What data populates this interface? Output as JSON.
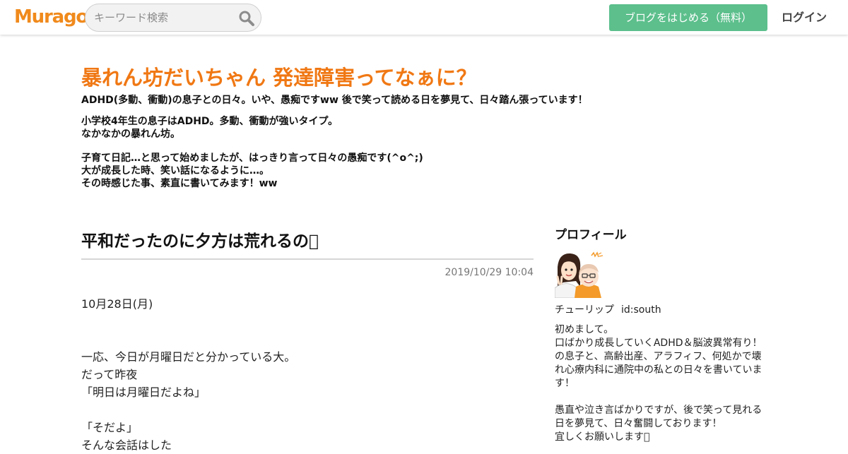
{
  "header": {
    "logo": "Muragon",
    "search_placeholder": "キーワード検索",
    "search_icon": "search-icon",
    "start_label": "ブログをはじめる（無料）",
    "login_label": "ログイン"
  },
  "blog": {
    "title": "暴れん坊だいちゃん 発達障害ってなぁに？",
    "desc": [
      "ADHD(多動、衝動)の息子との日々。いや、愚痴ですww  後で笑って読める日を夢見て、日々踏ん張っています！",
      "小学校4年生の息子はADHD。多動、衝動が強いタイプ。",
      "なかなかの暴れん坊。",
      "子育て日記…と思って始めましたが、はっきり言って日々の愚痴です(^o^;)",
      "大が成長した時、笑い話になるように…。",
      "その時感じた事、素直に書いてみます！ww"
    ]
  },
  "article": {
    "title": "平和だったのに夕方は荒れるの􀀀",
    "date": "2019/10/29 10:04",
    "body": [
      "10月28日(月)",
      "",
      "",
      "一応、今日が月曜日だと分かっている大。",
      "だって昨夜",
      "「明日は月曜日だよね」",
      "",
      "「そだよ」",
      "そんな会話はした"
    ]
  },
  "sidebar": {
    "heading": "プロフィール",
    "avatar_icon": "avatar",
    "name": "チューリップ",
    "id": "id:south",
    "bio": [
      "初めまして。",
      "口ばかり成長していくADHD＆脳波異常有り！の息子と、高齢出産、アラフィフ、何処かで壊れ心療内科に通院中の私との日々を書いています！",
      "",
      "愚直や泣き言ばかりですが、後で笑って見れる日を夢見て、日々奮闘しております！",
      "宜しくお願いします􀀀"
    ]
  },
  "colors": {
    "logo": "#f08a1c",
    "title": "#f07814",
    "start_button": "#5cbf8c"
  }
}
